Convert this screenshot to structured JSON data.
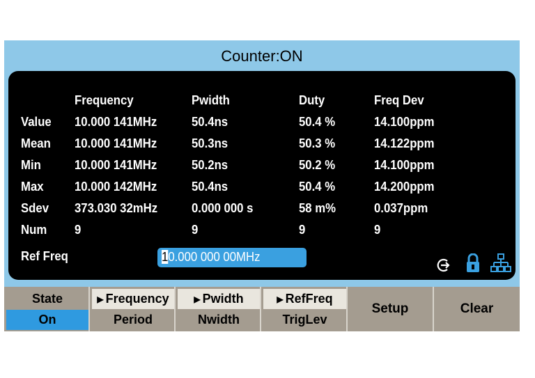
{
  "title": "Counter:ON",
  "columns": [
    "Frequency",
    "Pwidth",
    "Duty",
    "Freq Dev"
  ],
  "rows": [
    {
      "label": "Value",
      "cells": [
        "10.000 141MHz",
        "50.4ns",
        "50.4 %",
        "14.100ppm"
      ]
    },
    {
      "label": "Mean",
      "cells": [
        "10.000 141MHz",
        "50.3ns",
        "50.3 %",
        "14.122ppm"
      ]
    },
    {
      "label": "Min",
      "cells": [
        "10.000 141MHz",
        "50.2ns",
        "50.2 %",
        "14.100ppm"
      ]
    },
    {
      "label": "Max",
      "cells": [
        "10.000 142MHz",
        "50.4ns",
        "50.4 %",
        "14.200ppm"
      ]
    },
    {
      "label": "Sdev",
      "cells": [
        "373.030 32mHz",
        "0.000 000 s",
        "58 m%",
        "0.037ppm"
      ]
    },
    {
      "label": "Num",
      "cells": [
        "9",
        "9",
        "9",
        "9"
      ]
    }
  ],
  "ref_freq": {
    "label": "Ref Freq",
    "cursor_digit": "1",
    "value_rest": "0.000 000 00MHz"
  },
  "status_icons": [
    "arrow-enter-icon",
    "lock-icon",
    "network-icon"
  ],
  "softkeys": {
    "state": {
      "top": "State",
      "bottom": "On"
    },
    "frequency": {
      "top": "Frequency",
      "bottom": "Period"
    },
    "pwidth": {
      "top": "Pwidth",
      "bottom": "Nwidth"
    },
    "reffreq": {
      "top": "RefFreq",
      "bottom": "TrigLev"
    },
    "setup": "Setup",
    "clear": "Clear"
  },
  "colors": {
    "frame": "#8ec8e8",
    "panel": "#000000",
    "field": "#3aa0e0",
    "softkey": "#a49c90",
    "active": "#2f9ae0"
  }
}
